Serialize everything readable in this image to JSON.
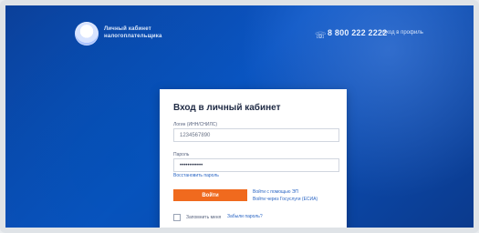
{
  "header": {
    "brand_lines": [
      "Личный кабинет",
      "налогоплательщика"
    ],
    "phone": "8 800 222 2222",
    "top_link": "Вход в профиль"
  },
  "login_card": {
    "title": "Вход в личный кабинет",
    "fields": {
      "login": {
        "label": "Логин (ИНН/СНИЛС)",
        "value": "1234567890"
      },
      "password": {
        "label": "Пароль",
        "value": "••••••••••••"
      }
    },
    "forgot_password": "Восстановить пароль",
    "login_button": "Войти",
    "alt_links": [
      "Войти с помощью ЭП",
      "Войти через Госуслуги (ЕСИА)"
    ],
    "remember_me": "Запомнить меня",
    "bottom_link": "Забыли пароль?"
  }
}
